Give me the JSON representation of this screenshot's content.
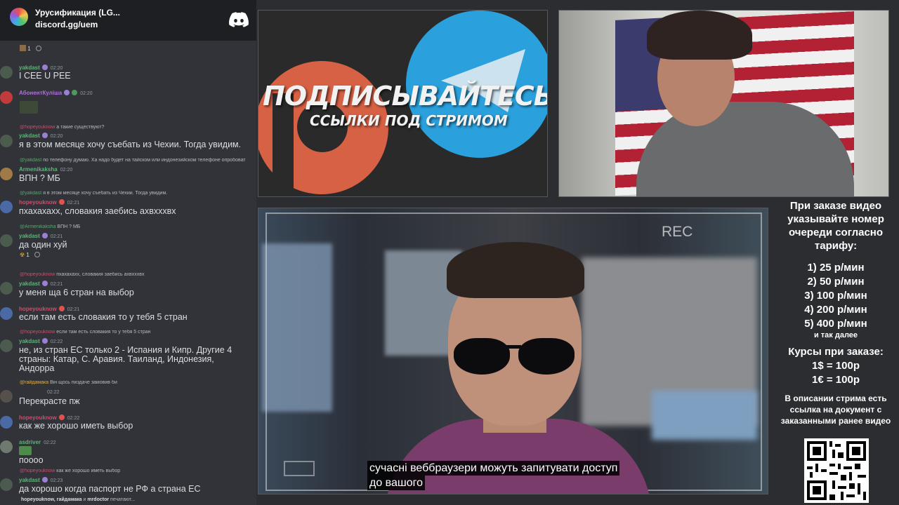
{
  "discord": {
    "server_name": "Урусификация (LG...",
    "invite": "discord.gg/uem",
    "top_reaction": "1",
    "typing": {
      "names": "hopeyouknow, гайдамака",
      "connector": "и",
      "last_name": "mrdoctor",
      "suffix": "печатают..."
    },
    "messages": [
      {
        "author": "yakdast",
        "time": "02:20",
        "text": "I CEE U PEE"
      },
      {
        "author": "АбонентКуліша",
        "time": "02:20",
        "text": ""
      },
      {
        "reply_name": "@hopeyouknow",
        "reply_text": "а такие существуют?",
        "author": "yakdast",
        "time": "02:20",
        "text": "я в этом месяце хочу съебать из Чехии. Тогда увидим."
      },
      {
        "reply_name": "@yakdast",
        "reply_text": "по телефону думаю. Ха надо будет на тайском или индонезийском телефоне опробоват",
        "author": "Armenikaksha",
        "time": "02:20",
        "text": "ВПН ? МБ"
      },
      {
        "reply_name": "@yakdast",
        "reply_text": "я в этом месяце хочу съебать из Чехии. Тогда увидим.",
        "author": "hopeyouknow",
        "time": "02:21",
        "text": "пхахахахх, словакия заебись ахвхххвх"
      },
      {
        "reply_name": "@Armenikaksha",
        "reply_text": "ВПН ? МБ",
        "author": "yakdast",
        "time": "02:21",
        "text": "да один хуй",
        "reaction": "1"
      },
      {
        "reply_name": "@hopeyouknow",
        "reply_text": "пхахахахх, словакия заебись ахвхххвх",
        "author": "yakdast",
        "time": "02:21",
        "text": "у меня ща 6 стран на выбор"
      },
      {
        "author": "hopeyouknow",
        "time": "02:21",
        "text": "если там есть словакия то у тебя 5 стран"
      },
      {
        "reply_name": "@hopeyouknow",
        "reply_text": "если там есть словакия то у тебя 5 стран",
        "author": "yakdast",
        "time": "02:22",
        "text": "не, из стран ЕС только 2 - Испания и Кипр. Другие 4 страны: Катар, С. Аравия. Таиланд, Индонезия, Андорра"
      },
      {
        "reply_name": "@гайдамака",
        "reply_text": "Вiн щось пиздаче замовив би",
        "author": "",
        "time": "02:22",
        "text": "Перекрасте пж"
      },
      {
        "author": "hopeyouknow",
        "time": "02:22",
        "text": "как же хорошо иметь выбор"
      },
      {
        "author": "asdriver",
        "time": "02:22",
        "text": "пoooo"
      },
      {
        "reply_name": "@hopeyouknow",
        "reply_text": "как же хорошо иметь выбор",
        "author": "yakdast",
        "time": "02:23",
        "text": "да хорошо когда паспорт не РФ а страна ЕС"
      }
    ]
  },
  "promo": {
    "title": "ПОДПИСЫВАЙТЕСЬ",
    "subtitle": "ССЫЛКИ ПОД СТРИМОМ"
  },
  "video": {
    "rec_label": "REC",
    "subtitle_line1": "сучасні веббраузери можуть запитувати доступ",
    "subtitle_line2": "до вашого"
  },
  "order": {
    "heading": "При заказе видео указывайте номер очереди согласно тарифу:",
    "tariffs": [
      "1) 25 р/мин",
      "2) 50 р/мин",
      "3) 100 р/мин",
      "4) 200 р/мин",
      "5) 400 р/мин"
    ],
    "tariff_etc": "и так далее",
    "rates_heading": "Курсы при заказе:",
    "rates": [
      "1$ = 100р",
      "1€ = 100р"
    ],
    "description_note": "В описании стрима есть ссылка на документ с заказанными ранее видео"
  },
  "colors": {
    "discord_bg": "#313338",
    "header_bg": "#1e1f22",
    "name_green": "#5fb37a",
    "name_red": "#c94f6d",
    "name_purple": "#b26ee0",
    "telegram_blue": "#2aa0dc",
    "patreon_orange": "#d76144"
  }
}
